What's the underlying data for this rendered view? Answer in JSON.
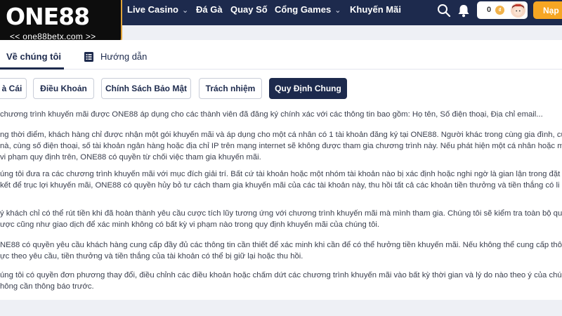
{
  "brand": {
    "logo_text": "ONE88",
    "domain": "<< one88betx.com >>",
    "accent": "#e0a33a"
  },
  "nav": {
    "items": [
      {
        "label": "Live Casino",
        "has_dropdown": true
      },
      {
        "label": "Đá Gà",
        "has_dropdown": false
      },
      {
        "label": "Quay Số",
        "has_dropdown": false
      },
      {
        "label": "Cổng Games",
        "has_dropdown": true
      },
      {
        "label": "Khuyến Mãi",
        "has_dropdown": false
      }
    ],
    "chevron": "⌄",
    "balance": "0",
    "coin_symbol": "₫",
    "deposit_label": "Nạp",
    "bg_color": "#1d2a4d"
  },
  "tabs": [
    {
      "label": "Về chúng tôi",
      "active": true
    },
    {
      "label": "Hướng dẫn",
      "active": false
    }
  ],
  "policy_buttons": [
    {
      "label": "à Cái",
      "active": false
    },
    {
      "label": "Điều Khoản",
      "active": false
    },
    {
      "label": "Chính Sách Bảo Mật",
      "active": false
    },
    {
      "label": "Trách nhiệm",
      "active": false
    },
    {
      "label": "Quy Định Chung",
      "active": true
    }
  ],
  "paragraphs": [
    [
      "chương trình khuyến mãi được ONE88 áp dụng cho các thành viên đã đăng ký chính xác với các thông tin bao gồm: Họ tên, Số điện thoại, Địa chỉ email..."
    ],
    [
      "ng thời điểm, khách hàng chỉ được nhận một gói khuyến mãi và áp dụng cho một cá nhân có 1 tài khoản đăng ký tại ONE88. Người khác trong cùng gia đình, cù",
      "nà, cùng số điện thoại, số tài khoản ngân hàng hoặc địa chỉ IP trên mạng internet sẽ không được tham gia chương trình này. Nếu phát hiện một cá nhân hoặc m",
      "vi phạm quy định trên, ONE88 có quyền từ chối việc tham gia khuyến mãi."
    ],
    [
      "úng tôi đưa ra các chương trình khuyến mãi với mục đích giải trí. Bất cứ tài khoản hoặc một nhóm tài khoản nào bị xác định hoặc nghi ngờ là gian lận trong đặt c",
      "kết để trục lợi khuyến mãi, ONE88 có quyền hủy bỏ tư cách tham gia khuyến mãi của các tài khoản này, thu hồi tất cả các khoản tiền thưởng và tiền thắng có li"
    ],
    [
      "ý khách chỉ có thể rút tiền khi đã hoàn thành yêu cầu cược tích lũy tương ứng với chương trình khuyến mãi mà mình tham gia. Chúng tôi sẽ kiểm tra toàn bộ qu",
      "ược cũng như giao dịch để xác minh không có bất kỳ vi phạm nào trong quy định khuyến mãi của chúng tôi."
    ],
    [
      "NE88 có quyền yêu cầu khách hàng cung cấp đầy đủ các thông tin cần thiết để xác minh khi cần để có thể hưởng tiền khuyến mãi. Nếu không thể cung cấp thôn",
      "ực theo yêu cầu, tiền thưởng và tiền thắng của tài khoản có thể bị giữ lại hoặc thu hồi."
    ],
    [
      "úng tôi có quyền đơn phương thay đổi, điều chỉnh các điều khoản hoặc chấm dứt các chương trình khuyến mãi vào bất kỳ thời gian và lý do nào theo ý của chún",
      "hông cần thông báo trước."
    ]
  ]
}
